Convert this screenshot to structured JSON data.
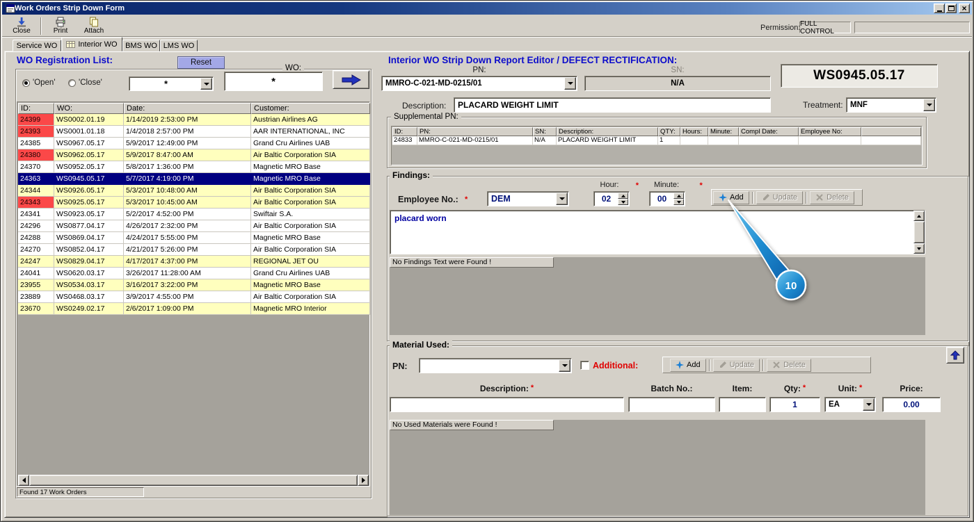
{
  "window": {
    "title": "Work Orders Strip Down Form"
  },
  "required_marker": "*",
  "toolbar": {
    "close_label": "Close",
    "print_label": "Print",
    "attach_label": "Attach",
    "permission_label": "Permission:",
    "permission_value": "FULL CONTROL"
  },
  "tabs": {
    "items": [
      {
        "label": "Service WO"
      },
      {
        "label": "Interior WO"
      },
      {
        "label": "BMS WO"
      },
      {
        "label": "LMS WO"
      }
    ]
  },
  "left": {
    "title": "WO Registration List:",
    "reset_label": "Reset",
    "group_caption": "WO:",
    "wo_filter_value": "*",
    "radio_open": "'Open'",
    "radio_close": "'Close'",
    "combo_filter_value": "*",
    "status": "Found 17 Work Orders",
    "table": {
      "headers": [
        "ID:",
        "WO:",
        "Date:",
        "Customer:"
      ],
      "rows": [
        {
          "id": "24399",
          "wo": "WS0002.01.19",
          "date": "1/14/2019 2:53:00 PM",
          "customer": "Austrian Airlines AG",
          "bg": "yellow",
          "id_red": true,
          "selected": false
        },
        {
          "id": "24393",
          "wo": "WS0001.01.18",
          "date": "1/4/2018 2:57:00 PM",
          "customer": "AAR INTERNATIONAL, INC",
          "bg": "white",
          "id_red": true,
          "selected": false
        },
        {
          "id": "24385",
          "wo": "WS0967.05.17",
          "date": "5/9/2017 12:49:00 PM",
          "customer": "Grand Cru Airlines UAB",
          "bg": "white",
          "id_red": false,
          "selected": false
        },
        {
          "id": "24380",
          "wo": "WS0962.05.17",
          "date": "5/9/2017 8:47:00 AM",
          "customer": "Air Baltic Corporation SIA",
          "bg": "yellow",
          "id_red": true,
          "selected": false
        },
        {
          "id": "24370",
          "wo": "WS0952.05.17",
          "date": "5/8/2017 1:36:00 PM",
          "customer": "Magnetic MRO Base",
          "bg": "white",
          "id_red": false,
          "selected": false
        },
        {
          "id": "24363",
          "wo": "WS0945.05.17",
          "date": "5/7/2017 4:19:00 PM",
          "customer": "Magnetic MRO Base",
          "bg": "white",
          "id_red": false,
          "selected": true
        },
        {
          "id": "24344",
          "wo": "WS0926.05.17",
          "date": "5/3/2017 10:48:00 AM",
          "customer": "Air Baltic Corporation SIA",
          "bg": "yellow",
          "id_red": false,
          "selected": false
        },
        {
          "id": "24343",
          "wo": "WS0925.05.17",
          "date": "5/3/2017 10:45:00 AM",
          "customer": "Air Baltic Corporation SIA",
          "bg": "yellow",
          "id_red": true,
          "selected": false
        },
        {
          "id": "24341",
          "wo": "WS0923.05.17",
          "date": "5/2/2017 4:52:00 PM",
          "customer": "Swiftair S.A.",
          "bg": "white",
          "id_red": false,
          "selected": false
        },
        {
          "id": "24296",
          "wo": "WS0877.04.17",
          "date": "4/26/2017 2:32:00 PM",
          "customer": "Air Baltic Corporation SIA",
          "bg": "white",
          "id_red": false,
          "selected": false
        },
        {
          "id": "24288",
          "wo": "WS0869.04.17",
          "date": "4/24/2017 5:55:00 PM",
          "customer": "Magnetic MRO Base",
          "bg": "white",
          "id_red": false,
          "selected": false
        },
        {
          "id": "24270",
          "wo": "WS0852.04.17",
          "date": "4/21/2017 5:26:00 PM",
          "customer": "Air Baltic Corporation SIA",
          "bg": "white",
          "id_red": false,
          "selected": false
        },
        {
          "id": "24247",
          "wo": "WS0829.04.17",
          "date": "4/17/2017 4:37:00 PM",
          "customer": "REGIONAL JET OU",
          "bg": "yellow",
          "id_red": false,
          "selected": false
        },
        {
          "id": "24041",
          "wo": "WS0620.03.17",
          "date": "3/26/2017 11:28:00 AM",
          "customer": "Grand Cru Airlines UAB",
          "bg": "white",
          "id_red": false,
          "selected": false
        },
        {
          "id": "23955",
          "wo": "WS0534.03.17",
          "date": "3/16/2017 3:22:00 PM",
          "customer": "Magnetic MRO Base",
          "bg": "yellow",
          "id_red": false,
          "selected": false
        },
        {
          "id": "23889",
          "wo": "WS0468.03.17",
          "date": "3/9/2017 4:55:00 PM",
          "customer": "Air Baltic Corporation SIA",
          "bg": "white",
          "id_red": false,
          "selected": false
        },
        {
          "id": "23670",
          "wo": "WS0249.02.17",
          "date": "2/6/2017 1:09:00 PM",
          "customer": "Magnetic MRO Interior",
          "bg": "yellow",
          "id_red": false,
          "selected": false
        }
      ]
    }
  },
  "right": {
    "title": "Interior WO Strip Down Report Editor / DEFECT RECTIFICATION:",
    "pn_label": "PN:",
    "pn_value": "MMRO-C-021-MD-0215/01",
    "sn_label": "SN:",
    "sn_value": "N/A",
    "wo_number": "WS0945.05.17",
    "description_label": "Description:",
    "description_value": "PLACARD WEIGHT LIMIT",
    "treatment_label": "Treatment:",
    "treatment_value": "MNF",
    "supplemental": {
      "title": "Supplemental PN:",
      "headers": [
        "ID:",
        "PN:",
        "SN:",
        "Description:",
        "QTY:",
        "Hours:",
        "Minute:",
        "Compl Date:",
        "Employee No:"
      ],
      "rows": [
        {
          "id": "24833",
          "pn": "MMRO-C-021-MD-0215/01",
          "sn": "N/A",
          "description": "PLACARD WEIGHT LIMIT",
          "qty": "1",
          "hours": "",
          "minute": "",
          "compl_date": "",
          "employee_no": ""
        }
      ]
    },
    "findings": {
      "caption": "Findings:",
      "employee_label": "Employee No.:",
      "employee_value": "DEM",
      "hour_label": "Hour:",
      "hour_value": "02",
      "minute_label": "Minute:",
      "minute_value": "00",
      "add_label": "Add",
      "update_label": "Update",
      "delete_label": "Delete",
      "text_value": "placard worn",
      "empty_message": "No Findings Text were Found !"
    },
    "material": {
      "caption": "Material Used:",
      "pn_label": "PN:",
      "additional_label": "Additional:",
      "add_label": "Add",
      "update_label": "Update",
      "delete_label": "Delete",
      "description_label": "Description:",
      "batch_label": "Batch No.:",
      "item_label": "Item:",
      "qty_label": "Qty:",
      "qty_value": "1",
      "unit_label": "Unit:",
      "unit_value": "EA",
      "price_label": "Price:",
      "price_value": "0.00",
      "empty_message": "No Used Materials were Found !"
    }
  },
  "annotation": {
    "label": "10"
  },
  "colors": {
    "accent_blue": "#0d0dcb",
    "callout_blue": "#1e8bd0",
    "selected_row": "#000080",
    "row_yellow": "#ffffbe",
    "id_red": "#fb4848",
    "required_red": "#e00000"
  }
}
